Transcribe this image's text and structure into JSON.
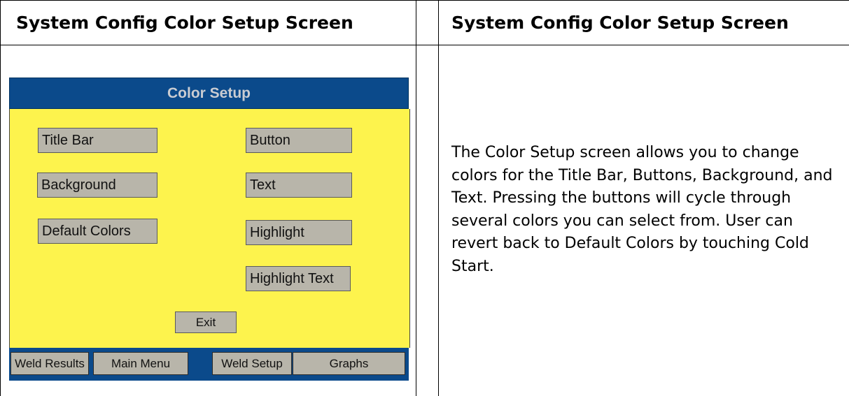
{
  "left_header": "System Config Color Setup Screen",
  "right_header": "System Config Color Setup Screen",
  "device": {
    "title": "Color Setup",
    "buttons": {
      "title_bar": "Title Bar",
      "button": "Button",
      "background": "Background",
      "text": "Text",
      "default_colors": "Default Colors",
      "highlight": "Highlight",
      "highlight_text": "Highlight Text",
      "exit": "Exit"
    },
    "tabs": [
      "Weld Results",
      "Main Menu",
      "Weld Setup",
      "Graphs"
    ],
    "colors": {
      "title_bar": "#0b4a8b",
      "background": "#fdf34d",
      "button": "#b8b5aa"
    }
  },
  "description": "The Color Setup screen allows you to change colors for the Title Bar, Buttons, Background, and Text. Pressing the buttons will cycle through several colors you can select from. User can revert back to Default Colors by touching Cold Start."
}
